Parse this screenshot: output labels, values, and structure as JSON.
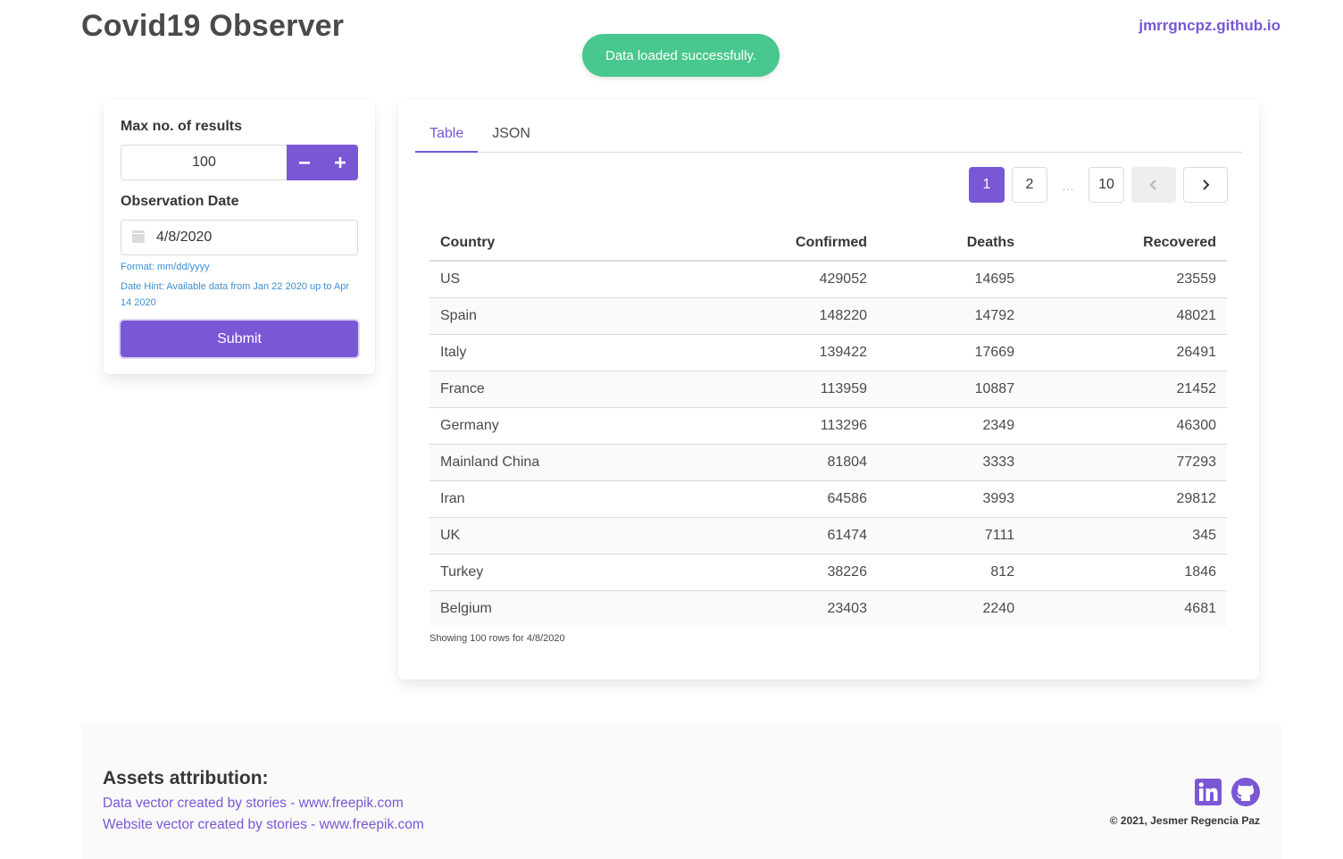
{
  "header": {
    "title": "Covid19 Observer",
    "site_link": "jmrrgncpz.github.io"
  },
  "toast": {
    "message": "Data loaded successfully.",
    "color": "#48c78e"
  },
  "filters": {
    "max_results_label": "Max no. of results",
    "max_results_value": "100",
    "date_label": "Observation Date",
    "date_value": "4/8/2020",
    "format_hint": "Format: mm/dd/yyyy",
    "date_hint": "Date Hint: Available data from Jan 22 2020 up to Apr 14 2020",
    "submit_label": "Submit",
    "minus_icon": "minus-icon",
    "plus_icon": "plus-icon",
    "calendar_icon": "calendar-icon"
  },
  "tabs": [
    {
      "label": "Table",
      "active": true
    },
    {
      "label": "JSON",
      "active": false
    }
  ],
  "pagination": {
    "pages": [
      "1",
      "2",
      "10"
    ],
    "current": "1",
    "ellipsis": "…",
    "prev_icon": "chevron-left-icon",
    "next_icon": "chevron-right-icon"
  },
  "table": {
    "columns": [
      "Country",
      "Confirmed",
      "Deaths",
      "Recovered"
    ],
    "rows": [
      [
        "US",
        "429052",
        "14695",
        "23559"
      ],
      [
        "Spain",
        "148220",
        "14792",
        "48021"
      ],
      [
        "Italy",
        "139422",
        "17669",
        "26491"
      ],
      [
        "France",
        "113959",
        "10887",
        "21452"
      ],
      [
        "Germany",
        "113296",
        "2349",
        "46300"
      ],
      [
        "Mainland China",
        "81804",
        "3333",
        "77293"
      ],
      [
        "Iran",
        "64586",
        "3993",
        "29812"
      ],
      [
        "UK",
        "61474",
        "7111",
        "345"
      ],
      [
        "Turkey",
        "38226",
        "812",
        "1846"
      ],
      [
        "Belgium",
        "23403",
        "2240",
        "4681"
      ]
    ],
    "caption": "Showing 100 rows for 4/8/2020"
  },
  "footer": {
    "attribution_title": "Assets attribution:",
    "links": [
      "Data vector created by stories - www.freepik.com",
      "Website vector created by stories - www.freepik.com"
    ],
    "copyright": "© 2021, Jesmer Regencia Paz",
    "social_icons": [
      "linkedin-icon",
      "github-icon"
    ]
  },
  "colors": {
    "accent": "#7957d5",
    "success": "#48c78e",
    "info": "#3e8ed0"
  }
}
